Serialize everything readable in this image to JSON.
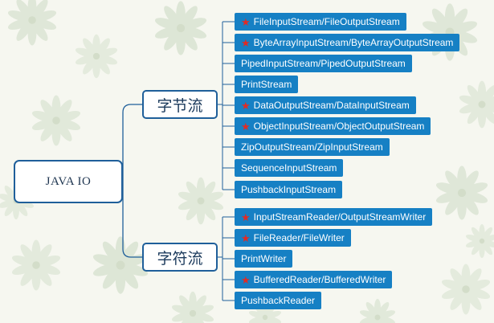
{
  "root": {
    "label": "JAVA IO"
  },
  "branches": [
    {
      "label": "字节流",
      "leaves": [
        {
          "label": "FileInputStream/FileOutputStream",
          "starred": true
        },
        {
          "label": "ByteArrayInputStream/ByteArrayOutputStream",
          "starred": true
        },
        {
          "label": "PipedInputStream/PipedOutputStream",
          "starred": false
        },
        {
          "label": "PrintStream",
          "starred": false
        },
        {
          "label": "DataOutputStream/DataInputStream",
          "starred": true
        },
        {
          "label": "ObjectInputStream/ObjectOutputStream",
          "starred": true
        },
        {
          "label": "ZipOutputStream/ZipInputStream",
          "starred": false
        },
        {
          "label": "SequenceInputStream",
          "starred": false
        },
        {
          "label": "PushbackInputStream",
          "starred": false
        }
      ]
    },
    {
      "label": "字符流",
      "leaves": [
        {
          "label": "InputStreamReader/OutputStreamWriter",
          "starred": true
        },
        {
          "label": "FileReader/FileWriter",
          "starred": true
        },
        {
          "label": "PrintWriter",
          "starred": false
        },
        {
          "label": "BufferedReader/BufferedWriter",
          "starred": true
        },
        {
          "label": "PushbackReader",
          "starred": false
        }
      ]
    }
  ],
  "colors": {
    "connector": "#1f5f9a",
    "leaf_fill": "#1680c4",
    "star": "#e02b25",
    "background": "#f6f7f0"
  },
  "icons": {
    "star": "star-icon"
  }
}
